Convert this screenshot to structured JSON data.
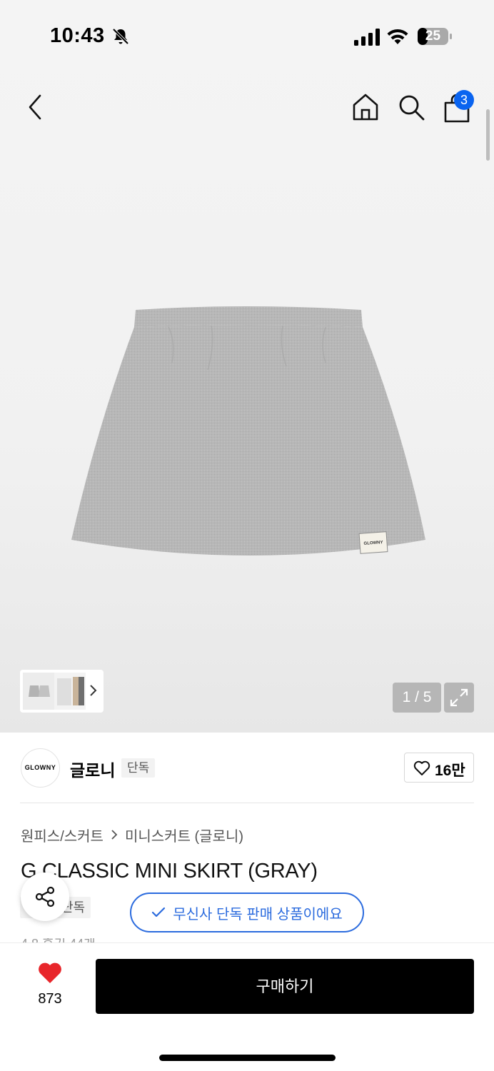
{
  "status_bar": {
    "time": "10:43",
    "battery": "25"
  },
  "nav": {
    "cart_count": "3"
  },
  "gallery": {
    "counter": "1 / 5"
  },
  "brand": {
    "logo_text": "GLOWNY",
    "name": "글로니",
    "tag": "단독",
    "likes": "16만"
  },
  "breadcrumb": {
    "category": "원피스/스커트",
    "subcategory": "미니스커트 (글로니)"
  },
  "product": {
    "title": "G CLASSIC MINI SKIRT (GRAY)",
    "exclusive_tag": "단독",
    "exclusive_notice": "무신사 단독 판매 상품이에요",
    "label_text": "GLOWNY"
  },
  "rating_peek": "4.8  후기 44개",
  "bottom_bar": {
    "wish_count": "873",
    "buy_label": "구매하기"
  },
  "colors": {
    "accent_blue": "#2b6bde",
    "badge_blue": "#0a64f0",
    "heart_red": "#e8262b",
    "skirt_gray": "#b9b9b9"
  }
}
